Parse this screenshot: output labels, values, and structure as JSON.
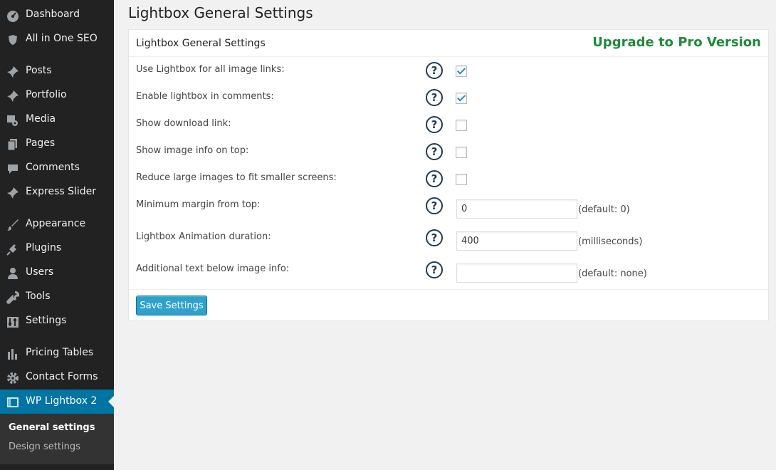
{
  "sidebar": {
    "items": [
      {
        "label": "Dashboard",
        "icon": "dashboard-icon"
      },
      {
        "label": "All in One SEO",
        "icon": "shield-icon"
      },
      {
        "label": "Posts",
        "icon": "pin-icon"
      },
      {
        "label": "Portfolio",
        "icon": "pin-icon"
      },
      {
        "label": "Media",
        "icon": "media-icon"
      },
      {
        "label": "Pages",
        "icon": "pages-icon"
      },
      {
        "label": "Comments",
        "icon": "comment-icon"
      },
      {
        "label": "Express Slider",
        "icon": "pin-icon"
      },
      {
        "label": "Appearance",
        "icon": "brush-icon"
      },
      {
        "label": "Plugins",
        "icon": "plug-icon"
      },
      {
        "label": "Users",
        "icon": "user-icon"
      },
      {
        "label": "Tools",
        "icon": "wrench-icon"
      },
      {
        "label": "Settings",
        "icon": "sliders-icon"
      },
      {
        "label": "Pricing Tables",
        "icon": "bar-chart-icon"
      },
      {
        "label": "Contact Forms",
        "icon": "gear-icon"
      },
      {
        "label": "WP Lightbox 2",
        "icon": "window-icon"
      }
    ],
    "submenu": [
      {
        "label": "General settings"
      },
      {
        "label": "Design settings"
      }
    ]
  },
  "page": {
    "title": "Lightbox General Settings"
  },
  "panel": {
    "title": "Lightbox General Settings",
    "upgrade_label": "Upgrade to Pro Version",
    "rows": [
      {
        "label": "Use Lightbox for all image links:",
        "checked": true
      },
      {
        "label": "Enable lightbox in comments:",
        "checked": true
      },
      {
        "label": "Show download link:",
        "checked": false
      },
      {
        "label": "Show image info on top:",
        "checked": false
      },
      {
        "label": "Reduce large images to fit smaller screens:",
        "checked": false
      },
      {
        "label": "Minimum margin from top:",
        "value": "0",
        "hint": "(default: 0)"
      },
      {
        "label": "Lightbox Animation duration:",
        "value": "400",
        "hint": "(milliseconds)"
      },
      {
        "label": "Additional text below image info:",
        "value": "",
        "hint": "(default: none)"
      }
    ],
    "help_glyph": "?",
    "save_label": "Save Settings"
  },
  "colors": {
    "sidebar_bg": "#222222",
    "current_bg": "#0074a2",
    "upgrade_text": "#1e8a3a",
    "button_bg": "#2ea2cc"
  }
}
